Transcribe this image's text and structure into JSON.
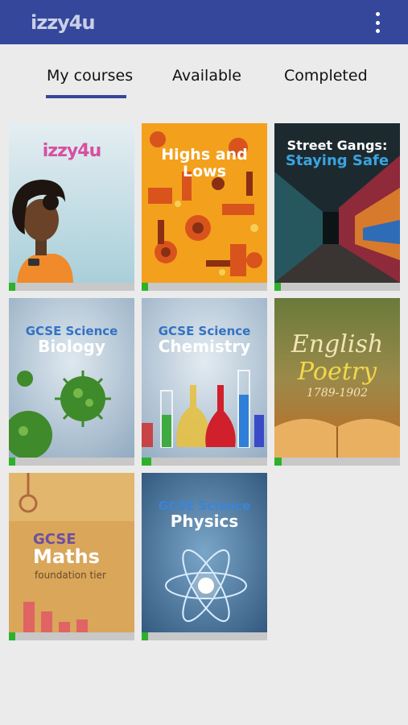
{
  "app": {
    "logo": "izzy4u"
  },
  "tabs": [
    {
      "label": "My courses",
      "active": true
    },
    {
      "label": "Available",
      "active": false
    },
    {
      "label": "Completed",
      "active": false
    }
  ],
  "courses": [
    {
      "line1": "izzy4u",
      "line2": "",
      "progress": 0.05
    },
    {
      "line1": "Highs and",
      "line2": "Lows",
      "progress": 0.05
    },
    {
      "line1": "Street Gangs:",
      "line2": "Staying Safe",
      "progress": 0.05
    },
    {
      "line1": "GCSE Science",
      "line2": "Biology",
      "progress": 0.05
    },
    {
      "line1": "GCSE Science",
      "line2": "Chemistry",
      "progress": 0.08
    },
    {
      "line1": "English",
      "line2": "Poetry",
      "line3": "1789-1902",
      "progress": 0.06
    },
    {
      "line1": "GCSE",
      "line2": "Maths",
      "line3": "foundation tier",
      "progress": 0.05
    },
    {
      "line1": "GCSE Science",
      "line2": "Physics",
      "progress": 0.05
    }
  ],
  "colors": {
    "appbar": "#35479b",
    "progress": "#2db12d"
  }
}
